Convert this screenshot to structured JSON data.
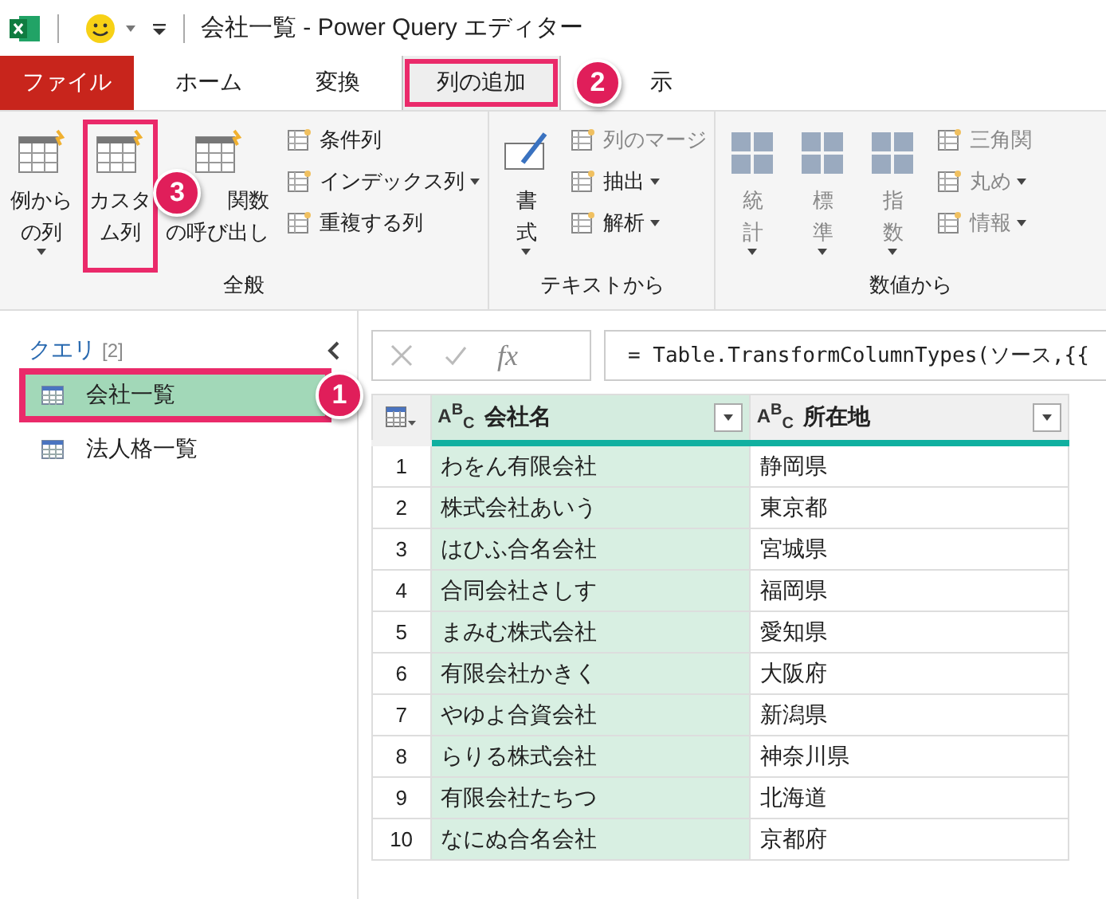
{
  "window": {
    "title": "会社一覧 - Power Query エディター"
  },
  "tabs": [
    {
      "label": "ファイル",
      "kind": "file",
      "selected": false,
      "highlighted": false
    },
    {
      "label": "ホーム",
      "kind": "tab",
      "selected": false,
      "highlighted": false
    },
    {
      "label": "変換",
      "kind": "tab",
      "selected": false,
      "highlighted": false
    },
    {
      "label": "列の追加",
      "kind": "tab",
      "selected": true,
      "highlighted": true,
      "callout": "2"
    },
    {
      "label": "示",
      "kind": "tab",
      "selected": false,
      "highlighted": false
    }
  ],
  "ribbon": {
    "groups": [
      {
        "label": "全般",
        "large": [
          {
            "label": "例からの列",
            "kind": "wide",
            "dropdown": true,
            "disabled": false,
            "highlighted": false
          },
          {
            "label": "カスタム列",
            "kind": "wide",
            "dropdown": false,
            "disabled": false,
            "highlighted": true,
            "callout": "3"
          },
          {
            "label": "関数の呼び出し",
            "kind": "indented",
            "dropdown": false,
            "disabled": false,
            "highlighted": false
          }
        ],
        "small": [
          {
            "label": "条件列",
            "dropdown": false,
            "disabled": false
          },
          {
            "label": "インデックス列",
            "dropdown": true,
            "disabled": false
          },
          {
            "label": "重複する列",
            "dropdown": false,
            "disabled": false
          }
        ]
      },
      {
        "label": "テキストから",
        "large": [
          {
            "label": "書式",
            "kind": "narrow",
            "dropdown": true,
            "disabled": false,
            "highlighted": false
          }
        ],
        "small": [
          {
            "label": "列のマージ",
            "dropdown": false,
            "disabled": true
          },
          {
            "label": "抽出",
            "dropdown": true,
            "disabled": false
          },
          {
            "label": "解析",
            "dropdown": true,
            "disabled": false
          }
        ]
      },
      {
        "label": "数値から",
        "large": [
          {
            "label": "統計",
            "kind": "narrow",
            "dropdown": true,
            "disabled": true,
            "highlighted": false
          },
          {
            "label": "標準",
            "kind": "narrow",
            "dropdown": true,
            "disabled": true,
            "highlighted": false
          },
          {
            "label": "指数",
            "kind": "narrow",
            "dropdown": true,
            "disabled": true,
            "highlighted": false
          }
        ],
        "small": [
          {
            "label": "三角関",
            "dropdown": false,
            "disabled": true
          },
          {
            "label": "丸め",
            "dropdown": true,
            "disabled": true
          },
          {
            "label": "情報",
            "dropdown": true,
            "disabled": true
          }
        ]
      }
    ]
  },
  "queries": {
    "title": "クエリ",
    "count": "[2]",
    "items": [
      {
        "label": "会社一覧",
        "selected": true,
        "highlighted": true,
        "callout": "1"
      },
      {
        "label": "法人格一覧",
        "selected": false,
        "highlighted": false
      }
    ]
  },
  "formula_bar": {
    "fx": "fx",
    "value": "= Table.TransformColumnTypes(ソース,{{"
  },
  "table": {
    "columns": [
      {
        "kind": "corner"
      },
      {
        "kind": "text",
        "type": "A$^{B}$$_{C}$",
        "label": "会社名",
        "selected": true
      },
      {
        "kind": "text",
        "type": "A$^{B}$$_{C}$",
        "label": "所在地",
        "selected": false
      }
    ],
    "rows": [
      [
        "1",
        "わをん有限会社",
        "静岡県"
      ],
      [
        "2",
        "株式会社あいう",
        "東京都"
      ],
      [
        "3",
        "はひふ合名会社",
        "宮城県"
      ],
      [
        "4",
        "合同会社さしす",
        "福岡県"
      ],
      [
        "5",
        "まみむ株式会社",
        "愛知県"
      ],
      [
        "6",
        "有限会社かきく",
        "大阪府"
      ],
      [
        "7",
        "やゆよ合資会社",
        "新潟県"
      ],
      [
        "8",
        "らりる株式会社",
        "神奈川県"
      ],
      [
        "9",
        "有限会社たちつ",
        "北海道"
      ],
      [
        "10",
        "なにぬ合名会社",
        "京都府"
      ]
    ]
  }
}
